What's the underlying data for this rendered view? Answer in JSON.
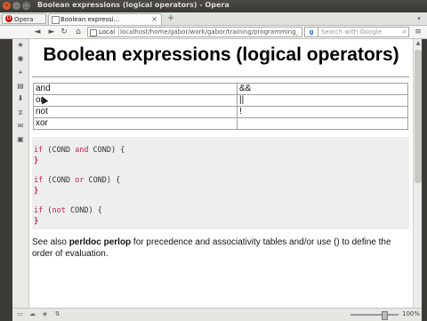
{
  "window": {
    "title": "Boolean expressions (logical operators) - Opera"
  },
  "tabs": {
    "menu_label": "Opera",
    "active_tab": "Boolean expressi...",
    "close": "×",
    "new_tab": "+",
    "tab_menu": "▾"
  },
  "toolbar": {
    "back": "◄",
    "forward": "►",
    "reload": "↻",
    "home": "⌂",
    "location_label": "Local",
    "url": "localhost/home/gabor/work/gabor/training/programming_pe",
    "search_placeholder": "Search with Google",
    "menu": "≡"
  },
  "sidebar": {
    "icons": [
      "star-icon",
      "speed-dial-icon",
      "share-icon",
      "notes-icon",
      "downloads-icon",
      "history-icon",
      "mail-icon",
      "panels-icon"
    ]
  },
  "page": {
    "title": "Boolean expressions (logical operators)",
    "operators": [
      {
        "word": "and",
        "symbol": "&&"
      },
      {
        "word": "or",
        "symbol": "||"
      },
      {
        "word": "not",
        "symbol": "!"
      },
      {
        "word": "xor",
        "symbol": ""
      }
    ],
    "code": [
      {
        "kw": "if",
        "cond": " (COND ",
        "op": "and",
        "rest": " COND) {"
      },
      {
        "close": "}"
      },
      {
        "kw": "if",
        "cond": " (COND ",
        "op": "or",
        "rest": " COND) {"
      },
      {
        "close": "}"
      },
      {
        "kw": "if",
        "cond": " (",
        "op": "not",
        "rest": " COND) {"
      },
      {
        "close": "}"
      }
    ],
    "see_also": {
      "prefix": "See also ",
      "bold": "perldoc perlop",
      "suffix": " for precedence and associativity tables and/or use () to define the order of evaluation."
    }
  },
  "status": {
    "zoom": "100%"
  }
}
